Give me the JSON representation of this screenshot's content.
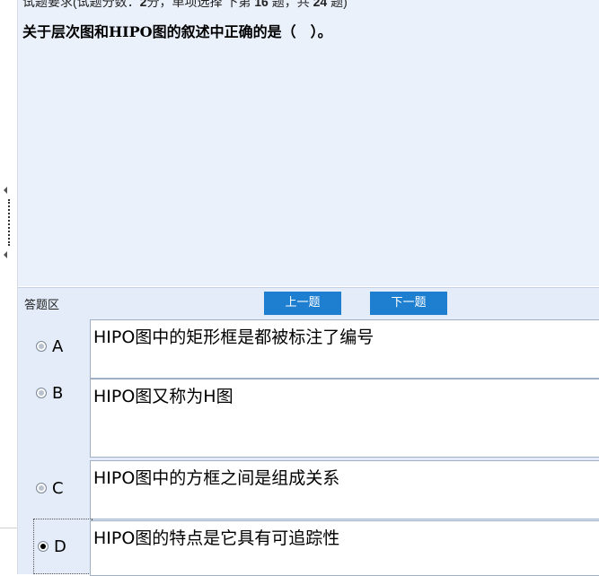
{
  "question": {
    "header_prefix": "试题要求(试题分数：",
    "score": "2",
    "header_mid": "分，单项选择 下第 ",
    "number": "16",
    "header_mid2": " 题，共 ",
    "total": "24",
    "header_suffix": " 题)",
    "text": "关于层次图和HIPO图的叙述中正确的是（　）。"
  },
  "answer_area": {
    "label": "答题区",
    "prev_label": "上一题",
    "next_label": "下一题"
  },
  "options": [
    {
      "letter": "A",
      "text": "HIPO图中的矩形框是都被标注了编号",
      "selected": false
    },
    {
      "letter": "B",
      "text": "HIPO图又称为H图",
      "selected": false
    },
    {
      "letter": "C",
      "text": "HIPO图中的方框之间是组成关系",
      "selected": false
    },
    {
      "letter": "D",
      "text": "HIPO图的特点是它具有可追踪性",
      "selected": true
    }
  ],
  "colors": {
    "accent": "#1e7fd0",
    "pane_bg": "#eaf1fb",
    "answer_bg": "#e3ecf8"
  }
}
